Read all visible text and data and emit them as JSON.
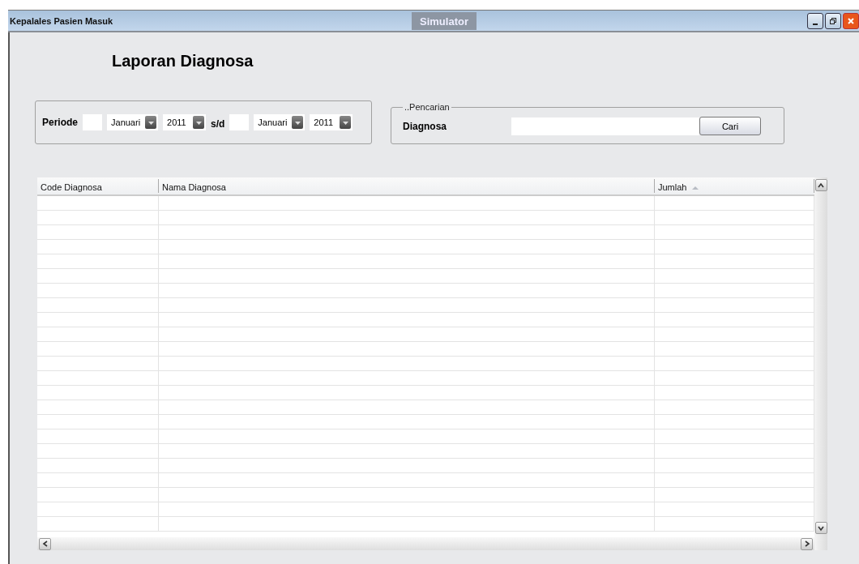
{
  "window": {
    "title": "Kepalales Pasien Masuk",
    "badge": "Simulator"
  },
  "heading": "Laporan Diagnosa",
  "periode": {
    "label": "Periode",
    "from": {
      "month": "Januari",
      "year": "2011"
    },
    "separator": "s/d",
    "to": {
      "month": "Januari",
      "year": "2011"
    }
  },
  "search": {
    "legend": "..Pencarian",
    "label": "Diagnosa",
    "button": "Cari"
  },
  "table": {
    "columns": [
      {
        "label": "Code Diagnosa",
        "sorted": false
      },
      {
        "label": "Nama Diagnosa",
        "sorted": false
      },
      {
        "label": "Jumlah",
        "sorted": true
      }
    ]
  }
}
